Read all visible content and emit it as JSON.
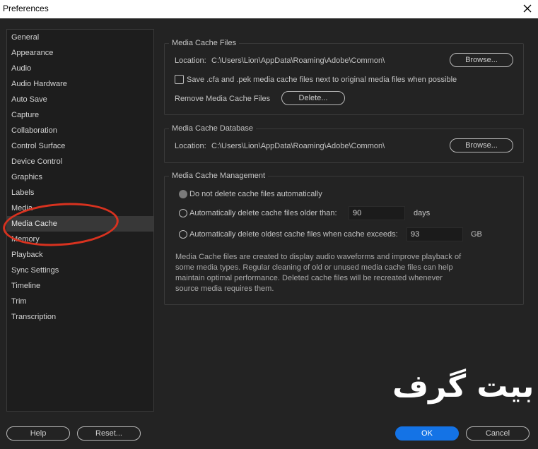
{
  "window": {
    "title": "Preferences"
  },
  "sidebar": {
    "items": [
      {
        "label": "General"
      },
      {
        "label": "Appearance"
      },
      {
        "label": "Audio"
      },
      {
        "label": "Audio Hardware"
      },
      {
        "label": "Auto Save"
      },
      {
        "label": "Capture"
      },
      {
        "label": "Collaboration"
      },
      {
        "label": "Control Surface"
      },
      {
        "label": "Device Control"
      },
      {
        "label": "Graphics"
      },
      {
        "label": "Labels"
      },
      {
        "label": "Media"
      },
      {
        "label": "Media Cache",
        "selected": true
      },
      {
        "label": "Memory"
      },
      {
        "label": "Playback"
      },
      {
        "label": "Sync Settings"
      },
      {
        "label": "Timeline"
      },
      {
        "label": "Trim"
      },
      {
        "label": "Transcription"
      }
    ]
  },
  "cache_files": {
    "title": "Media Cache Files",
    "location_label": "Location:",
    "location_path": "C:\\Users\\Lion\\AppData\\Roaming\\Adobe\\Common\\",
    "browse_label": "Browse...",
    "save_checkbox_label": "Save .cfa and .pek media cache files next to original media files when possible",
    "save_checked": false,
    "remove_label": "Remove Media Cache Files",
    "delete_label": "Delete..."
  },
  "cache_database": {
    "title": "Media Cache Database",
    "location_label": "Location:",
    "location_path": "C:\\Users\\Lion\\AppData\\Roaming\\Adobe\\Common\\",
    "browse_label": "Browse..."
  },
  "cache_management": {
    "title": "Media Cache Management",
    "option_no_delete": "Do not delete cache files automatically",
    "option_older_than": "Automatically delete cache files older than:",
    "older_than_value": "90",
    "older_than_unit": "days",
    "option_exceeds": "Automatically delete oldest cache files when cache exceeds:",
    "exceeds_value": "93",
    "exceeds_unit": "GB",
    "description_lines": [
      "Media Cache files are created to display audio waveforms and improve playback of",
      "some media types.  Regular cleaning of old or unused media cache files can help",
      "maintain optimal performance. Deleted cache files will be recreated whenever",
      "source media requires them."
    ]
  },
  "footer": {
    "help_label": "Help",
    "reset_label": "Reset...",
    "ok_label": "OK",
    "cancel_label": "Cancel"
  },
  "watermark": {
    "text": "بیت گرف"
  },
  "colors": {
    "background": "#232323",
    "panel": "#1d1d1d",
    "selected": "#383838",
    "accent": "#1473e6",
    "annotation": "#d8321f"
  },
  "icons": {
    "close": "close-icon"
  }
}
